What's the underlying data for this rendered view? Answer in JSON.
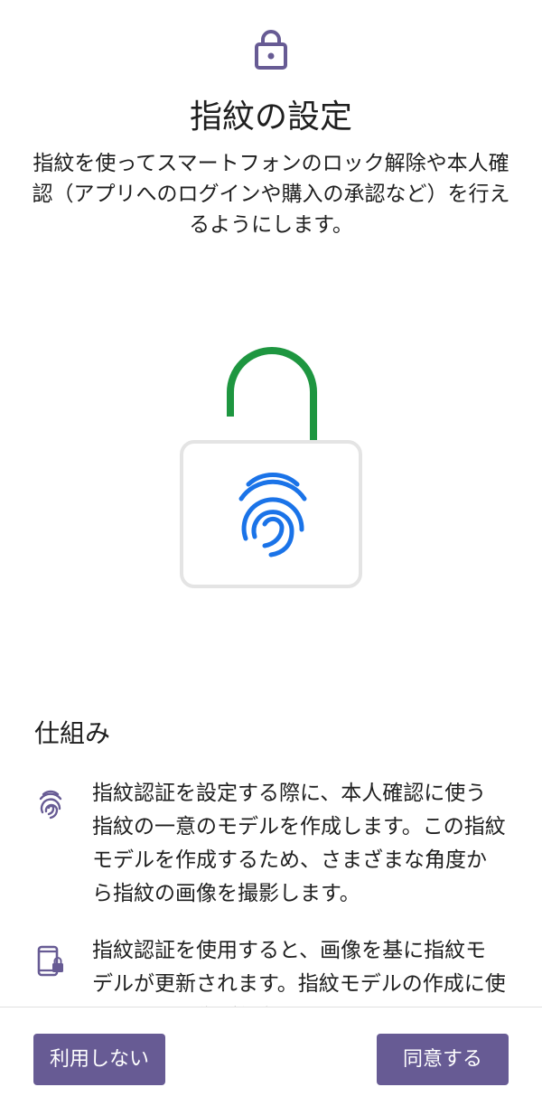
{
  "header": {
    "title": "指紋の設定",
    "description": "指紋を使ってスマートフォンのロック解除や本人確認（アプリへのログインや購入の承認など）を行えるようにします。",
    "icon": "lock-icon"
  },
  "illustration": {
    "icon": "unlocked-padlock-fingerprint-illustration"
  },
  "how_it_works": {
    "heading": "仕組み",
    "items": [
      {
        "icon": "fingerprint-icon",
        "text": "指紋認証を設定する際に、本人確認に使う指紋の一意のモデルを作成します。この指紋モデルを作成するため、さまざまな角度から指紋の画像を撮影します。"
      },
      {
        "icon": "phone-lock-icon",
        "text": "指紋認証を使用すると、画像を基に指紋モデルが更新されます。指紋モデルの作成に使用された画像が保存されることはありません。"
      }
    ]
  },
  "buttons": {
    "skip_label": "利用しない",
    "agree_label": "同意する"
  },
  "colors": {
    "accent": "#675b94",
    "lock_green": "#1e9640",
    "fingerprint_blue": "#1a73e8"
  }
}
